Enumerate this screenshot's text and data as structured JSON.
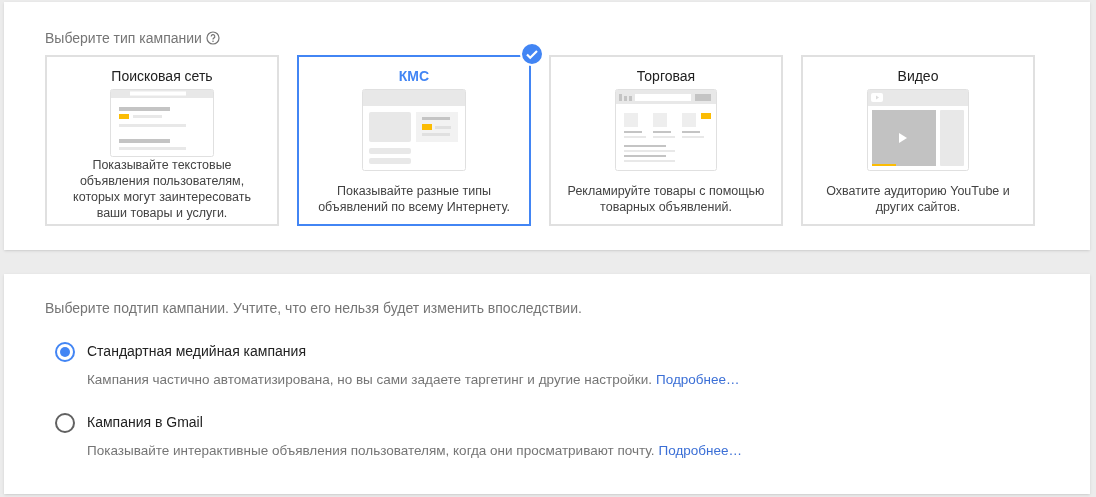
{
  "type_section": {
    "label": "Выберите тип кампании",
    "cards": [
      {
        "kind": "search",
        "title": "Поисковая сеть",
        "description": "Показывайте текстовые объявления пользователям, которых могут заинтересовать ваши товары и услуги.",
        "selected": false
      },
      {
        "kind": "display",
        "title": "КМС",
        "description": "Показывайте разные типы объявлений по всему Интернету.",
        "selected": true
      },
      {
        "kind": "shopping",
        "title": "Торговая",
        "description": "Рекламируйте товары с помощью товарных объявлений.",
        "selected": false
      },
      {
        "kind": "video",
        "title": "Видео",
        "description": "Охватите аудиторию YouTube и других сайтов.",
        "selected": false
      }
    ]
  },
  "subtype_section": {
    "label": "Выберите подтип кампании. Учтите, что его нельзя будет изменить впоследствии.",
    "options": [
      {
        "title": "Стандартная медийная кампания",
        "description": "Кампания частично автоматизирована, но вы сами задаете таргетинг и другие настройки.",
        "link": "Подробнее…",
        "selected": true
      },
      {
        "title": "Кампания в Gmail",
        "description": "Показывайте интерактивные объявления пользователям, когда они просматривают почту.",
        "link": "Подробнее…",
        "selected": false
      }
    ]
  }
}
